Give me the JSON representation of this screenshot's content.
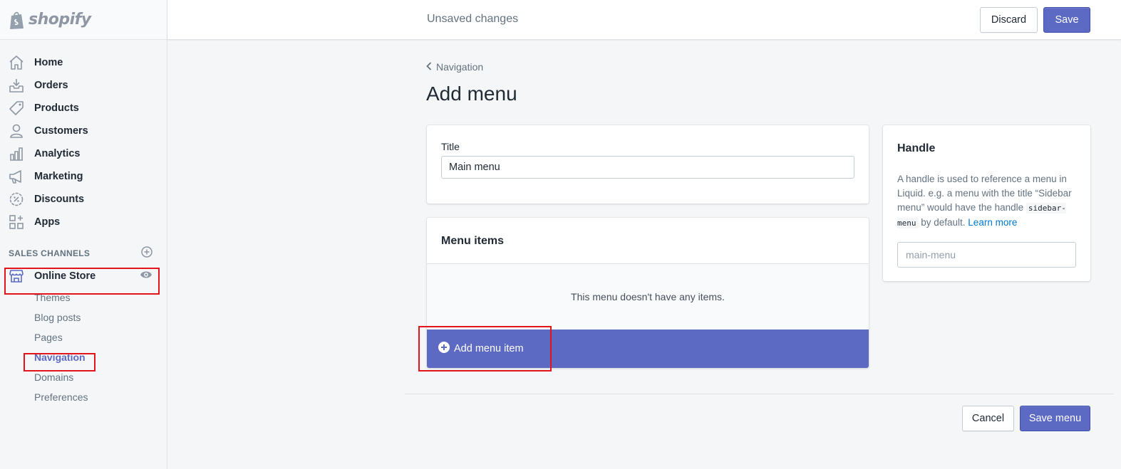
{
  "brand": {
    "name": "shopify"
  },
  "topbar": {
    "status": "Unsaved changes",
    "discard_label": "Discard",
    "save_label": "Save"
  },
  "sidebar": {
    "items": [
      {
        "label": "Home",
        "icon": "home-icon"
      },
      {
        "label": "Orders",
        "icon": "orders-icon"
      },
      {
        "label": "Products",
        "icon": "tag-icon"
      },
      {
        "label": "Customers",
        "icon": "person-icon"
      },
      {
        "label": "Analytics",
        "icon": "bar-chart-icon"
      },
      {
        "label": "Marketing",
        "icon": "megaphone-icon"
      },
      {
        "label": "Discounts",
        "icon": "discount-icon"
      },
      {
        "label": "Apps",
        "icon": "apps-icon"
      }
    ],
    "sales_channels_heading": "SALES CHANNELS",
    "online_store": {
      "label": "Online Store",
      "subitems": [
        "Themes",
        "Blog posts",
        "Pages",
        "Navigation",
        "Domains",
        "Preferences"
      ],
      "active": "Navigation"
    }
  },
  "main": {
    "breadcrumb": "Navigation",
    "page_title": "Add menu",
    "title_card": {
      "label": "Title",
      "value": "Main menu"
    },
    "menu_items": {
      "heading": "Menu items",
      "empty_text": "This menu doesn't have any items.",
      "add_label": "Add menu item"
    },
    "handle": {
      "heading": "Handle",
      "desc_1": "A handle is used to reference a menu in Liquid. e.g. a menu with the title “Sidebar menu” would have the handle ",
      "code": "sidebar-menu",
      "desc_2": " by default. ",
      "link": "Learn more",
      "placeholder": "main-menu"
    },
    "footer": {
      "cancel_label": "Cancel",
      "save_menu_label": "Save menu"
    }
  },
  "colors": {
    "primary": "#5c6ac4",
    "highlight": "#e4141b",
    "link": "#007ace"
  }
}
